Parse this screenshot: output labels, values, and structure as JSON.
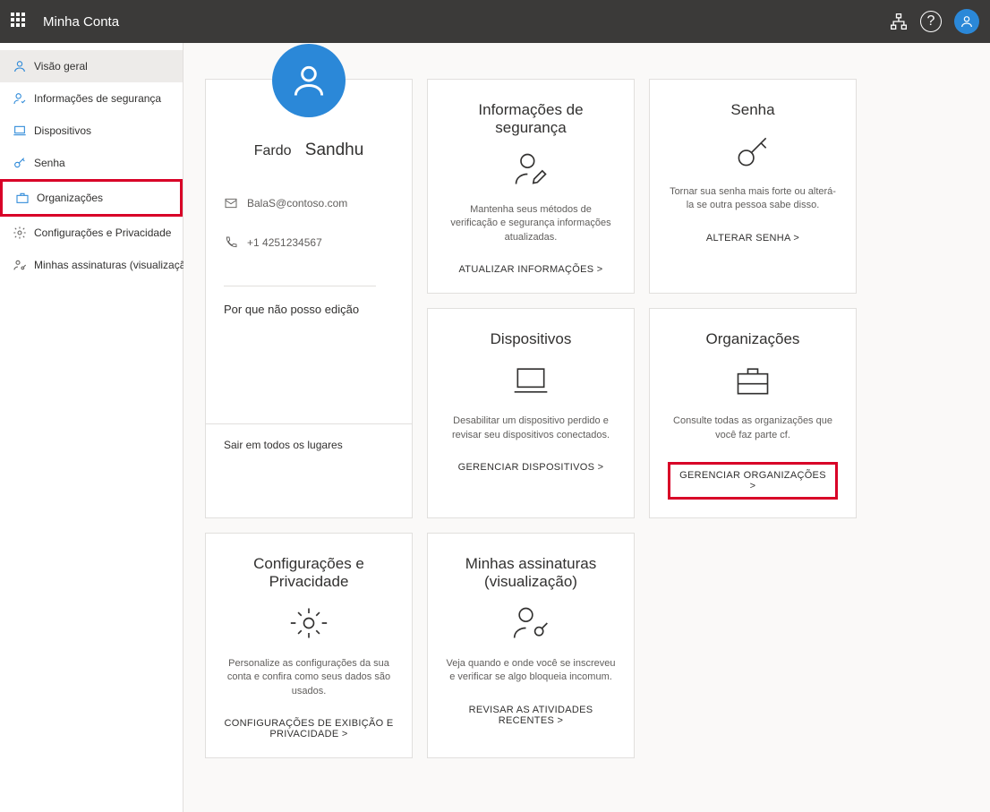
{
  "topbar": {
    "title": "Minha Conta"
  },
  "sidebar": {
    "items": [
      {
        "label": "Visão geral"
      },
      {
        "label": "Informações de segurança"
      },
      {
        "label": "Dispositivos"
      },
      {
        "label": "Senha"
      },
      {
        "label": "Organizações"
      },
      {
        "label": "Configurações e Privacidade"
      },
      {
        "label": "Minhas assinaturas (visualização)"
      }
    ]
  },
  "profile": {
    "first_name": "Fardo",
    "last_name": "Sandhu",
    "email": "BalaS@contoso.com",
    "phone": "+1 4251234567",
    "edit_question": "Por que não posso edição",
    "signout_everywhere": "Sair em todos os lugares"
  },
  "cards": {
    "security": {
      "title": "Informações de segurança",
      "desc": "Mantenha seus métodos de verificação e segurança informações atualizadas.",
      "action": "ATUALIZAR INFORMAÇÕES &gt;"
    },
    "password": {
      "title": "Senha",
      "desc": "Tornar sua senha mais forte ou alterá-la se outra pessoa sabe disso.",
      "action": "ALTERAR SENHA &gt;"
    },
    "devices": {
      "title": "Dispositivos",
      "desc": "Desabilitar um dispositivo perdido e revisar seu dispositivos conectados.",
      "action": "GERENCIAR DISPOSITIVOS &gt;"
    },
    "orgs": {
      "title": "Organizações",
      "desc": "Consulte todas as organizações que você faz parte cf.",
      "action": "GERENCIAR ORGANIZAÇÕES &gt;"
    },
    "settings": {
      "title": "Configurações e Privacidade",
      "desc": "Personalize as configurações da sua conta e confira como seus dados são usados.",
      "action": "CONFIGURAÇÕES DE EXIBIÇÃO E PRIVACIDADE &gt;"
    },
    "subs": {
      "title": "Minhas assinaturas (visualização)",
      "desc": "Veja quando e onde você se inscreveu e verificar se algo bloqueia incomum.",
      "action": "REVISAR AS ATIVIDADES RECENTES &gt;"
    }
  }
}
